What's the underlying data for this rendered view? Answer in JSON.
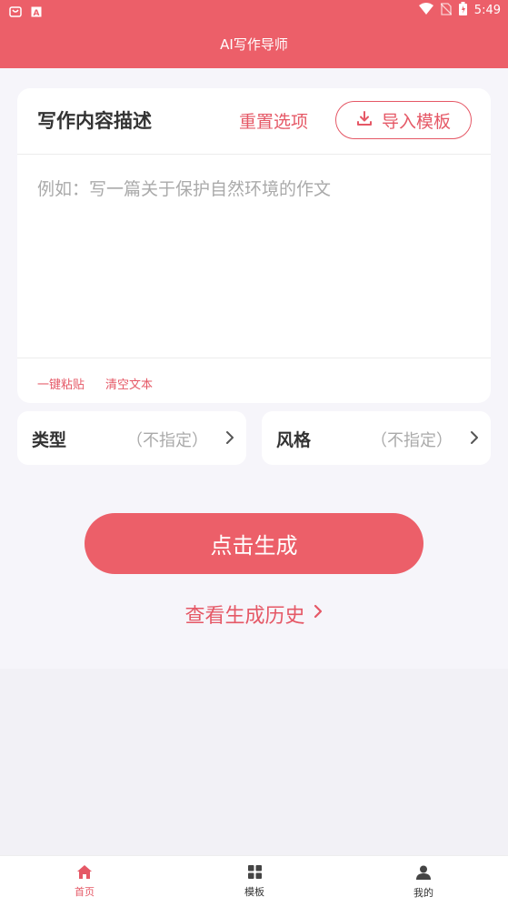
{
  "status_bar": {
    "time": "5:49"
  },
  "app": {
    "title": "AI写作导师"
  },
  "card": {
    "title": "写作内容描述",
    "reset_label": "重置选项",
    "import_label": "导入模板",
    "placeholder": "例如：写一篇关于保护自然环境的作文",
    "paste_label": "一键粘贴",
    "clear_label": "清空文本"
  },
  "options": [
    {
      "label": "类型",
      "value": "（不指定）"
    },
    {
      "label": "风格",
      "value": "（不指定）"
    }
  ],
  "generate_label": "点击生成",
  "history_label": "查看生成历史",
  "tabs": [
    {
      "label": "首页",
      "icon": "home-icon",
      "active": true
    },
    {
      "label": "模板",
      "icon": "grid-icon",
      "active": false
    },
    {
      "label": "我的",
      "icon": "person-icon",
      "active": false
    }
  ],
  "colors": {
    "accent": "#ec5f69",
    "accent_text": "#e55866",
    "background": "#f2f1f6"
  }
}
